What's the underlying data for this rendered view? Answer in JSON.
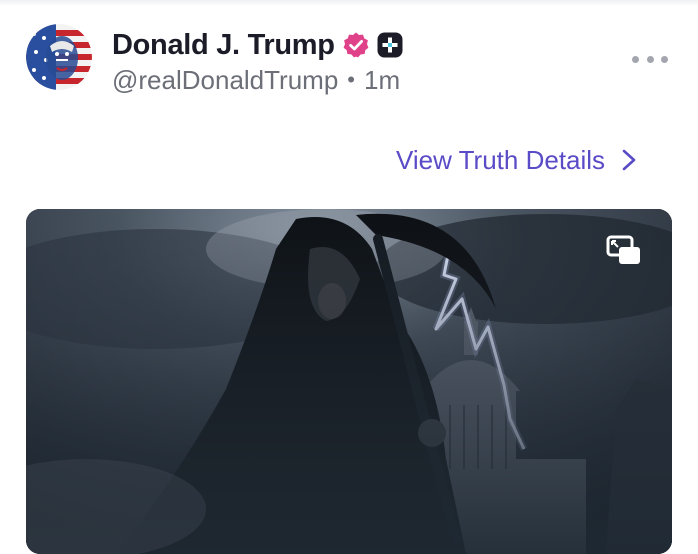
{
  "post": {
    "author_name": "Donald J. Trump",
    "handle": "@realDonaldTrump",
    "separator": "•",
    "time_ago": "1m"
  },
  "actions": {
    "view_details_label": "View Truth Details"
  },
  "icons": {
    "verified": "verified-badge-icon",
    "plus": "plus-badge-icon",
    "more": "more-options-icon",
    "chevron": "chevron-right-icon",
    "pip": "picture-in-picture-icon"
  },
  "colors": {
    "accent": "#5a4bc7",
    "verified_badge": "#e0428a",
    "text_primary": "#1c1c28",
    "text_secondary": "#6c6f78"
  }
}
